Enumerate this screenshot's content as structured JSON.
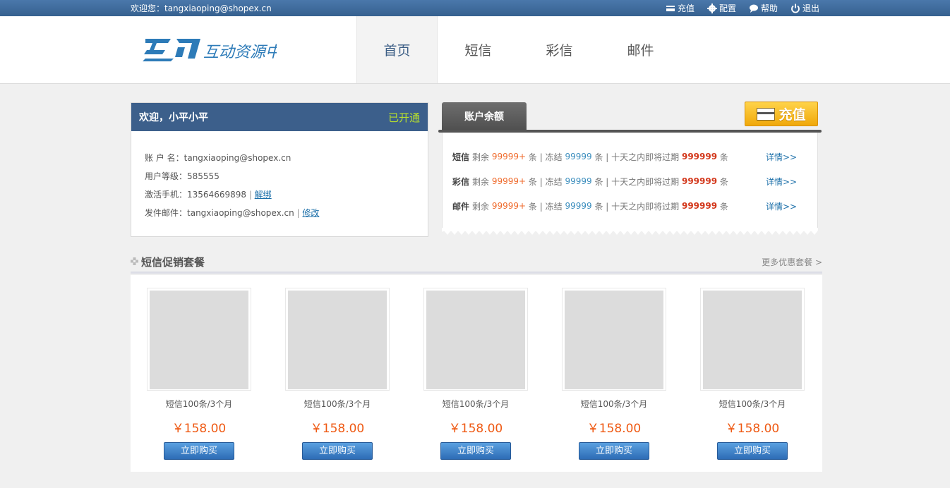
{
  "topbar": {
    "welcome": "欢迎您：tangxiaoping@shopex.cn",
    "links": [
      {
        "label": "充值",
        "icon": "card-icon"
      },
      {
        "label": "配置",
        "icon": "gear-icon"
      },
      {
        "label": "帮助",
        "icon": "chat-icon"
      },
      {
        "label": "退出",
        "icon": "power-icon"
      }
    ]
  },
  "logo": {
    "text": "互动资源中心"
  },
  "nav": {
    "items": [
      {
        "label": "首页",
        "active": true
      },
      {
        "label": "短信"
      },
      {
        "label": "彩信"
      },
      {
        "label": "邮件"
      }
    ]
  },
  "account": {
    "greeting": "欢迎，小平小平",
    "status": "已开通",
    "rows": [
      {
        "label": "账 户 名：",
        "value": "tangxiaoping@shopex.cn"
      },
      {
        "label": "用户等级：",
        "value": "585555"
      },
      {
        "label": "激活手机：",
        "value": "13564669898",
        "sep": " | ",
        "link": "解绑"
      },
      {
        "label": "发件邮件：",
        "value": "tangxiaoping@shopex.cn",
        "sep": " | ",
        "link": "修改"
      }
    ]
  },
  "balance": {
    "tab": "账户余额",
    "recharge": "充值",
    "rows": [
      {
        "type": "短信",
        "remain_label": "剩余",
        "remain": "99999+",
        "unit1": "条 | 冻结",
        "frozen": "99999",
        "unit2": "条 | 十天之内即将过期",
        "expire": "999999",
        "unit3": "条",
        "detail": "详情>>"
      },
      {
        "type": "彩信",
        "remain_label": "剩余",
        "remain": "99999+",
        "unit1": "条 | 冻结",
        "frozen": "99999",
        "unit2": "条 | 十天之内即将过期",
        "expire": "999999",
        "unit3": "条",
        "detail": "详情>>"
      },
      {
        "type": "邮件",
        "remain_label": "剩余",
        "remain": "99999+",
        "unit1": "条 | 冻结",
        "frozen": "99999",
        "unit2": "条 | 十天之内即将过期",
        "expire": "999999",
        "unit3": "条",
        "detail": "详情>>"
      }
    ]
  },
  "promo": {
    "title": "短信促销套餐",
    "more": "更多优惠套餐 >",
    "products": [
      {
        "name": "短信100条/3个月",
        "price": "￥158.00",
        "buy": "立即购买"
      },
      {
        "name": "短信100条/3个月",
        "price": "￥158.00",
        "buy": "立即购买"
      },
      {
        "name": "短信100条/3个月",
        "price": "￥158.00",
        "buy": "立即购买"
      },
      {
        "name": "短信100条/3个月",
        "price": "￥158.00",
        "buy": "立即购买"
      },
      {
        "name": "短信100条/3个月",
        "price": "￥158.00",
        "buy": "立即购买"
      }
    ]
  },
  "colors": {
    "topbar": "#3d6a9e",
    "account_head": "#3c5f8b",
    "status": "#b8e02d",
    "price": "#ef5a14",
    "buy": "#2d6cb5"
  }
}
